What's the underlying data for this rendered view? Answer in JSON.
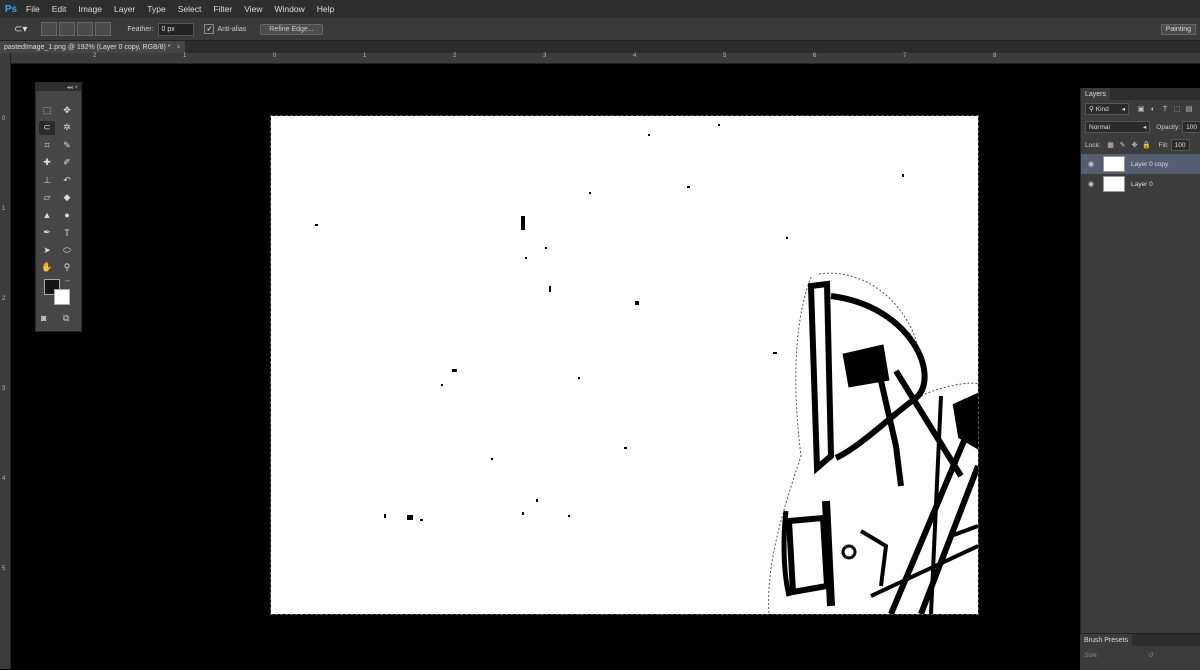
{
  "app": {
    "logo": "Ps"
  },
  "menu": [
    "File",
    "Edit",
    "Image",
    "Layer",
    "Type",
    "Select",
    "Filter",
    "View",
    "Window",
    "Help"
  ],
  "options": {
    "feather_label": "Feather:",
    "feather_value": "0 px",
    "antialias_label": "Anti-alias",
    "refine_label": "Refine Edge...",
    "workspace": "Painting"
  },
  "document": {
    "tab_title": "pastedImage_1.png @ 192% (Layer 0 copy, RGB/8) *",
    "close": "×"
  },
  "ruler": {
    "top_labels": [
      "2",
      "1",
      "0",
      "1",
      "2",
      "3",
      "4",
      "5",
      "6",
      "7",
      "8"
    ],
    "left_labels": [
      "0",
      "1",
      "2",
      "3",
      "4",
      "5"
    ]
  },
  "toolbox": {
    "collapse": "◂◂ ×",
    "tools": [
      {
        "name": "rectangular-marquee-icon",
        "glyph": "⬚"
      },
      {
        "name": "move-icon",
        "glyph": "✥"
      },
      {
        "name": "lasso-icon",
        "glyph": "⊂"
      },
      {
        "name": "magic-wand-icon",
        "glyph": "✲"
      },
      {
        "name": "crop-icon",
        "glyph": "⌗"
      },
      {
        "name": "eyedropper-icon",
        "glyph": "✎"
      },
      {
        "name": "spot-healing-icon",
        "glyph": "✚"
      },
      {
        "name": "brush-icon",
        "glyph": "✐"
      },
      {
        "name": "clone-stamp-icon",
        "glyph": "⊥"
      },
      {
        "name": "history-brush-icon",
        "glyph": "↶"
      },
      {
        "name": "eraser-icon",
        "glyph": "▱"
      },
      {
        "name": "paint-bucket-icon",
        "glyph": "◆"
      },
      {
        "name": "blur-icon",
        "glyph": "▲"
      },
      {
        "name": "dodge-icon",
        "glyph": "●"
      },
      {
        "name": "pen-icon",
        "glyph": "✒"
      },
      {
        "name": "type-icon",
        "glyph": "T"
      },
      {
        "name": "path-selection-icon",
        "glyph": "➤"
      },
      {
        "name": "ellipse-icon",
        "glyph": "⬭"
      },
      {
        "name": "hand-icon",
        "glyph": "✋"
      },
      {
        "name": "zoom-icon",
        "glyph": "⚲"
      }
    ]
  },
  "layers_panel": {
    "tab": "Layers",
    "filter_kind": "Kind",
    "blend_mode": "Normal",
    "opacity_label": "Opacity:",
    "opacity_value": "100",
    "lock_label": "Lock:",
    "fill_label": "Fill:",
    "fill_value": "100",
    "layers": [
      {
        "name": "Layer 0 copy",
        "selected": true
      },
      {
        "name": "Layer 0",
        "selected": false
      }
    ]
  },
  "brush_panel": {
    "tab": "Brush Presets",
    "size_label": "Size:"
  }
}
